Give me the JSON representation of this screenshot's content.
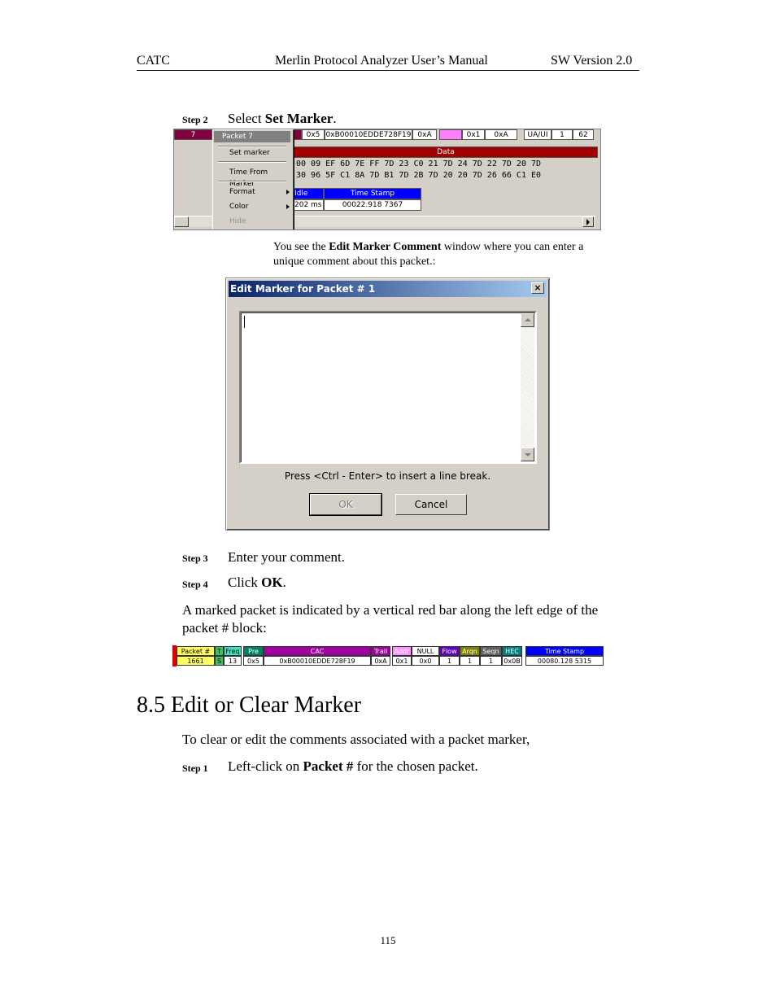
{
  "header": {
    "left": "CATC",
    "center": "Merlin Protocol Analyzer User’s Manual",
    "right": "SW Version 2.0"
  },
  "step2": {
    "label": "Step 2",
    "text_pre": "Select ",
    "text_bold": "Set Marker",
    "text_post": "."
  },
  "screenshot1": {
    "packet_num": "7",
    "fields": [
      "0x5",
      "0xB00010EDDE728F19",
      "0xA",
      "0x1",
      "0xA",
      "UA/UI",
      "1",
      "62"
    ],
    "data_header": "Data",
    "hex_row1": "00 09 EF 6D 7E FF 7D 23 C0 21 7D 24 7D 22 7D 20 7D",
    "hex_row2": "30 96 5F C1 8A 7D B1 7D 2B 7D 20 20 7D 26 66 C1 E0",
    "idle_header": "Idle",
    "idle_value": "202 ms",
    "timestamp_header": "Time Stamp",
    "timestamp_value": "00022.918 7367",
    "context_menu": {
      "title": "Packet 7",
      "items": [
        "Set marker",
        "Time From Marker",
        "Format",
        "Color",
        "Hide"
      ]
    }
  },
  "caption": {
    "pre": "You see the ",
    "bold": "Edit Marker Comment",
    "post1": " window where you can enter a",
    "post2": "unique comment about this packet.:"
  },
  "dialog": {
    "title": "Edit Marker for Packet # 1",
    "close": "×",
    "hint": "Press <Ctrl - Enter> to insert a line break.",
    "ok_label": "OK",
    "cancel_label": "Cancel"
  },
  "step3": {
    "label": "Step 3",
    "text": "Enter your comment."
  },
  "step4": {
    "label": "Step 4",
    "text_pre": "Click ",
    "text_bold": "OK",
    "text_post": "."
  },
  "marked_para": {
    "line1": "A marked packet is indicated by a vertical red bar along the left edge of the",
    "line2": "packet # block:"
  },
  "strip": {
    "headers": [
      "Packet #",
      "T",
      "Freq",
      "Pre",
      "CAC",
      "Trail",
      "Addr",
      "NULL",
      "Flow",
      "Arqn",
      "Seqn",
      "HEC",
      "Time Stamp"
    ],
    "values": [
      "1661",
      "S",
      "13",
      "0x5",
      "0xB00010EDDE728F19",
      "0xA",
      "0x1",
      "0x0",
      "1",
      "1",
      "1",
      "0x0B",
      "00080.128 5315"
    ]
  },
  "section": {
    "title": "8.5  Edit or Clear Marker"
  },
  "section_para": "To clear or edit the comments associated with a packet marker,",
  "step1": {
    "label": "Step 1",
    "text_pre": "Left-click on ",
    "text_bold": "Packet #",
    "text_post": " for the chosen packet."
  },
  "footer": {
    "page_number": "115"
  }
}
